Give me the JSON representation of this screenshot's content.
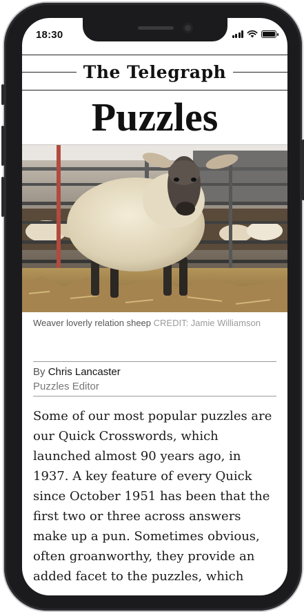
{
  "status_bar": {
    "time": "18:30"
  },
  "masthead": {
    "brand": "The Telegraph"
  },
  "page": {
    "section_title": "Puzzles"
  },
  "hero_image": {
    "subject": "sheep",
    "caption": "Weaver loverly relation sheep",
    "credit": "CREDIT: Jamie Williamson"
  },
  "byline": {
    "prefix": "By",
    "author": "Chris Lancaster",
    "role": "Puzzles Editor"
  },
  "article": {
    "body": "Some of our most popular puzzles are our Quick Crosswords, which launched almost 90 years ago, in 1937. A key feature of every Quick since October 1951 has been that the first two or three across answers make up a pun. Sometimes obvious, often groanworthy, they provide an added facet to the puzzles, which"
  },
  "icons": {
    "signal": "cellular-signal-icon",
    "wifi": "wifi-icon",
    "battery": "battery-icon"
  }
}
